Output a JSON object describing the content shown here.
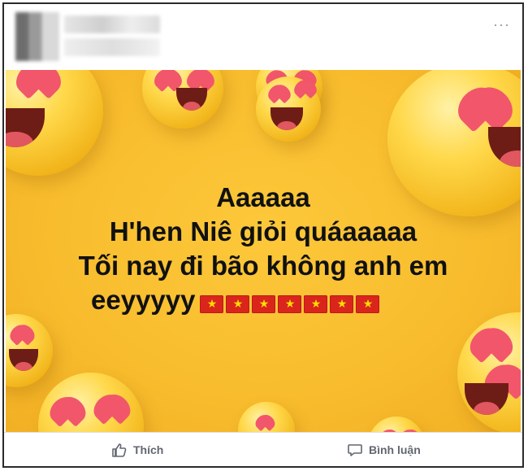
{
  "post": {
    "status_lines": [
      "Aaaaaa",
      "H'hen Niê giỏi quáaaaaa",
      "Tối nay đi bão không anh em",
      "eeyyyyy"
    ],
    "flag_count": 7,
    "flag_emoji_name": "vietnam-flag-icon",
    "background_color": "#f8bd2e",
    "text_color": "#111111"
  },
  "actions": {
    "like_label": "Thích",
    "comment_label": "Bình luận"
  },
  "icons": {
    "like": "thumbs-up-icon",
    "comment": "comment-bubble-icon",
    "options": "more-options-icon"
  }
}
